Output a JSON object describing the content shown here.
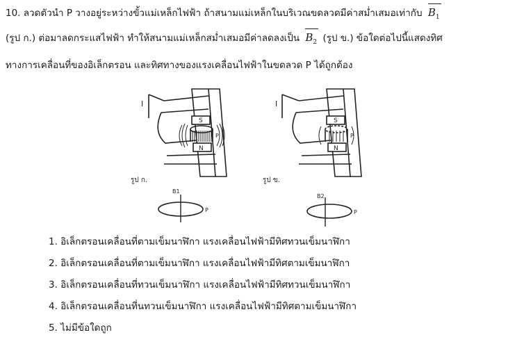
{
  "question": {
    "number": "10.",
    "line1_text": "ลวดตัวนำ P วางอยู่ระหว่างขั้วแม่เหล็กไฟฟ้า ถ้าสนามแม่เหล็กในบริเวณขดลวดมีค่าสม่ำเสมอเท่ากับ",
    "vec1_letter": "B",
    "vec1_sub": "1",
    "line2_before": "(รูป ก.) ต่อมาลดกระแสไฟฟ้า ทำให้สนามแม่เหล็กสม่ำเสมอมีค่าลดลงเป็น",
    "vec2_letter": "B",
    "vec2_sub": "2",
    "line2_after": "(รูป ข.) ข้อใดต่อไปนี้แสดงทิศ",
    "line3": "ทางการเคลื่อนที่ของอิเล็กตรอน และทิศทางของแรงเคลื่อนไฟฟ้าในขดลวด P ได้ถูกต้อง"
  },
  "figure_a": {
    "caption": "รูป ก.",
    "current_label": "I",
    "pole_top": "S",
    "pole_bottom": "N",
    "wire_label": "P",
    "field_label": "B1",
    "loop_label": "P"
  },
  "figure_b": {
    "caption": "รูป ข.",
    "current_label": "I",
    "pole_top": "S",
    "pole_bottom": "N",
    "wire_label": "P",
    "field_label": "B2",
    "loop_label": "P"
  },
  "choices": [
    "1. อิเล็กตรอนเคลื่อนที่ตามเข็มนาฬิกา แรงเคลื่อนไฟฟ้ามีทิศทวนเข็มนาฬิกา",
    "2. อิเล็กตรอนเคลื่อนที่ตามเข็มนาฬิกา แรงเคลื่อนไฟฟ้ามีทิศตามเข็มนาฬิกา",
    "3. อิเล็กตรอนเคลื่อนที่ทวนเข็มนาฬิกา แรงเคลื่อนไฟฟ้ามีทิศทวนเข็มนาฬิกา",
    "4. อิเล็กตรอนเคลื่อนที่นทวนเข็มนาฬิกา แรงเคลื่อนไฟฟ้ามีทิศตามเข็มนาฬิกา",
    "5. ไม่มีข้อใดถูก"
  ]
}
